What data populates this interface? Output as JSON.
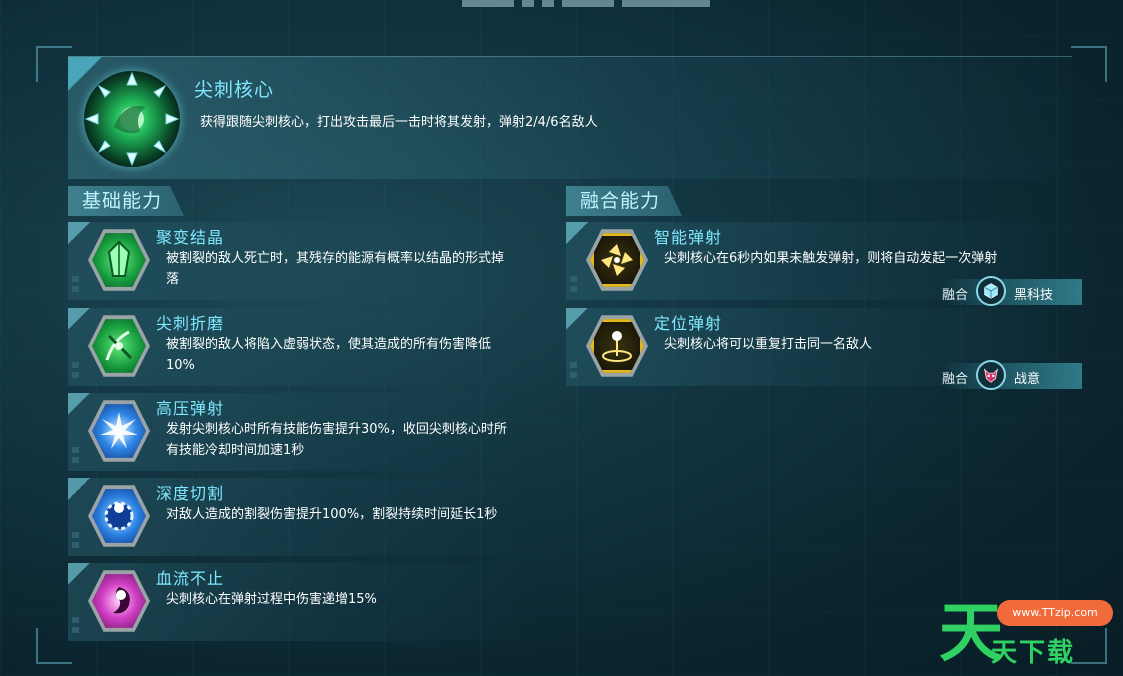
{
  "header": {
    "title": "尖刺核心",
    "description": "获得跟随尖刺核心，打出攻击最后一击时将其发射，弹射2/4/6名敌人"
  },
  "sections": {
    "basic_label": "基础能力",
    "fusion_label": "融合能力"
  },
  "basic_abilities": [
    {
      "title": "聚变结晶",
      "desc": "被割裂的敌人死亡时，其残存的能源有概率以结晶的形式掉落",
      "icon": "crystal-icon",
      "color": "#2fcf55"
    },
    {
      "title": "尖刺折磨",
      "desc": "被割裂的敌人将陷入虚弱状态，使其造成的所有伤害降低10%",
      "icon": "thorn-vine-icon",
      "color": "#2fcf55"
    },
    {
      "title": "高压弹射",
      "desc": "发射尖刺核心时所有技能伤害提升30%，收回尖刺核心时所有技能冷却时间加速1秒",
      "icon": "burst-icon",
      "color": "#2a7fe0"
    },
    {
      "title": "深度切割",
      "desc": "对敌人造成的割裂伤害提升100%，割裂持续时间延长1秒",
      "icon": "saw-blade-icon",
      "color": "#2a7fe0"
    },
    {
      "title": "血流不止",
      "desc": "尖刺核心在弹射过程中伤害递增15%",
      "icon": "blood-vortex-icon",
      "color": "#d13fc4"
    }
  ],
  "fusion_abilities": [
    {
      "title": "智能弹射",
      "desc": "尖刺核心在6秒内如果未触发弹射，则将自动发起一次弹射",
      "icon": "smart-bounce-icon",
      "color": "#e0b820",
      "fusion": {
        "prefix": "融合",
        "name": "黑科技",
        "icon": "cube-icon"
      }
    },
    {
      "title": "定位弹射",
      "desc": "尖刺核心将可以重复打击同一名敌人",
      "icon": "target-bounce-icon",
      "color": "#e0b820",
      "fusion": {
        "prefix": "融合",
        "name": "战意",
        "icon": "demon-mask-icon"
      }
    }
  ],
  "watermark": {
    "char": "天",
    "url": "www.TTzip.com",
    "sub": "天下载"
  }
}
